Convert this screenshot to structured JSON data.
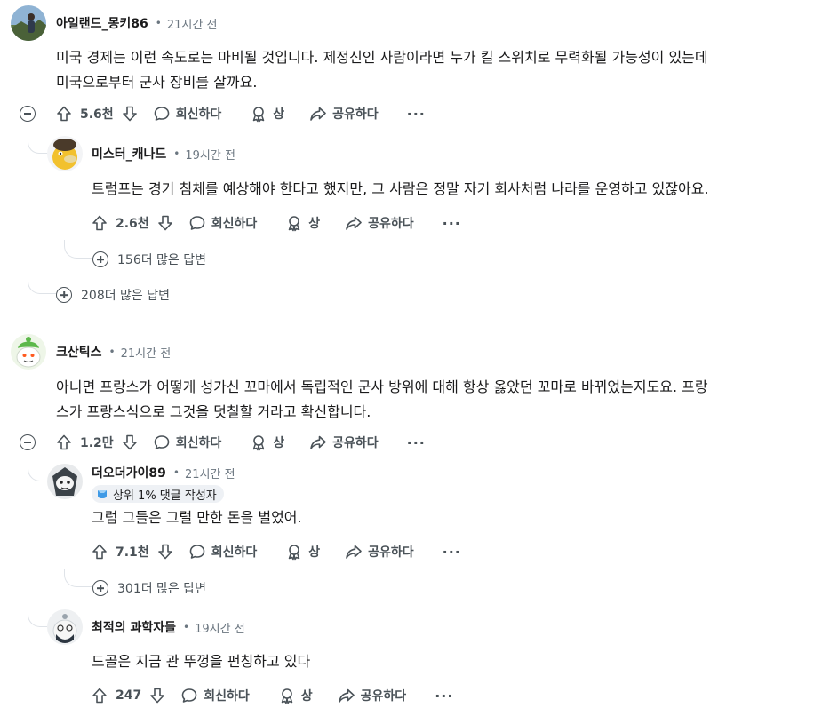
{
  "actions": {
    "reply": "회신하다",
    "award": "상",
    "share": "공유하다"
  },
  "comments": [
    {
      "author": "아일랜드_몽키86",
      "time": "21시간 전",
      "text_lines": [
        "미국 경제는 이런 속도로는 마비될 것입니다. 제정신인 사람이라면 누가 킬 스위치로 무력화될 가능성이 있는데",
        "미국으로부터 군사 장비를 살까요."
      ],
      "votes": "5.6천",
      "more_replies": "208더 많은 답변",
      "replies": [
        {
          "author": "미스터_캐나드",
          "time": "19시간 전",
          "text_lines": [
            "트럼프는 경기 침체를 예상해야 한다고 했지만, 그 사람은 정말 자기 회사처럼 나라를 운영하고 있잖아요."
          ],
          "votes": "2.6천",
          "more_replies": "156더 많은 답변"
        }
      ]
    },
    {
      "author": "크산틱스",
      "time": "21시간 전",
      "text_lines": [
        "아니면 프랑스가 어떻게 성가신 꼬마에서 독립적인 군사 방위에 대해 항상 옳았던 꼬마로 바뀌었는지도요. 프랑",
        "스가 프랑스식으로 그것을 덧칠할 거라고 확신합니다."
      ],
      "votes": "1.2만",
      "replies": [
        {
          "author": "더오더가이89",
          "time": "21시간 전",
          "flair": "상위 1% 댓글 작성자",
          "text_lines": [
            "그럼 그들은 그럴 만한 돈을 벌었어."
          ],
          "votes": "7.1천",
          "more_replies": "301더 많은 답변"
        },
        {
          "author": "최적의 과학자들",
          "time": "19시간 전",
          "text_lines": [
            "드골은 지금 관 뚜껑을 펀칭하고 있다"
          ],
          "votes": "247"
        }
      ]
    }
  ]
}
